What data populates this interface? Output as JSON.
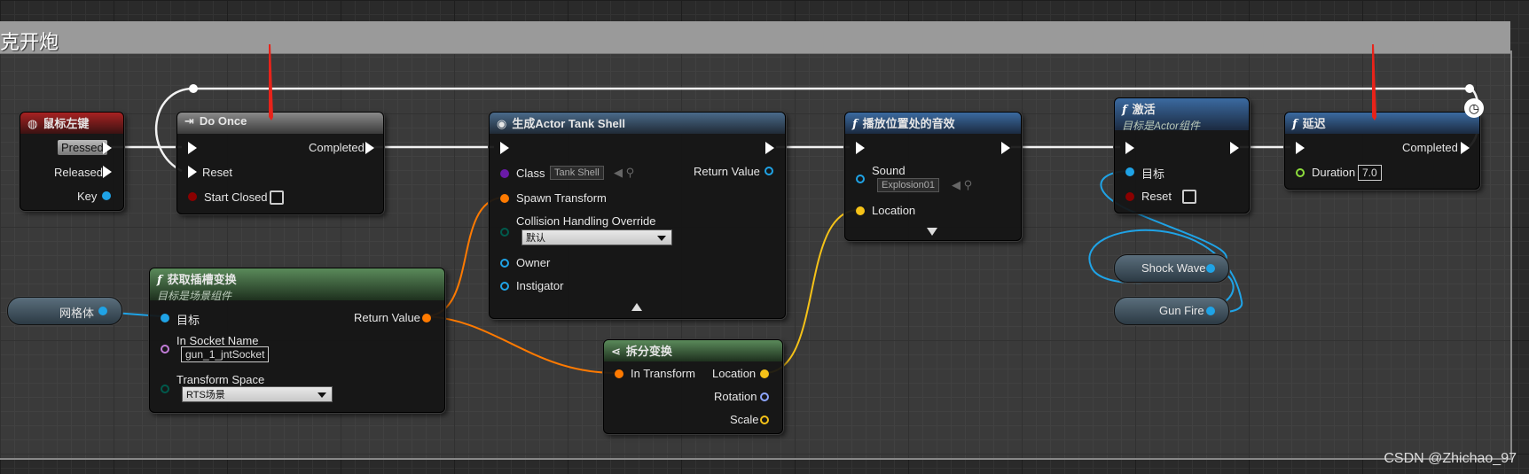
{
  "comment": {
    "title": "克开炮"
  },
  "nodes": {
    "mouse": {
      "title": "鼠标左键",
      "pins": [
        "Pressed",
        "Released",
        "Key"
      ]
    },
    "do_once": {
      "title": "Do Once",
      "pins": [
        "Reset",
        "Start Closed",
        "Completed"
      ]
    },
    "spawn": {
      "title": "生成Actor Tank Shell",
      "class_label": "Class",
      "class_value": "Tank Shell",
      "spawn_transform": "Spawn Transform",
      "collision": "Collision Handling Override",
      "collision_value": "默认",
      "owner": "Owner",
      "instigator": "Instigator",
      "return_value": "Return Value"
    },
    "sound": {
      "title": "播放位置处的音效",
      "sound_label": "Sound",
      "sound_value": "Explosion01",
      "location": "Location"
    },
    "activate": {
      "title": "激活",
      "subtitle": "目标是Actor组件",
      "target": "目标",
      "reset": "Reset"
    },
    "delay": {
      "title": "延迟",
      "completed": "Completed",
      "duration_label": "Duration",
      "duration_value": "7.0"
    },
    "socket": {
      "title": "获取插槽变换",
      "subtitle": "目标是场景组件",
      "target": "目标",
      "socket_name_label": "In Socket Name",
      "socket_name_value": "gun_1_jntSocket",
      "transform_space_label": "Transform Space",
      "transform_space_value": "RTS场景",
      "return_value": "Return Value"
    },
    "break": {
      "title": "拆分变换",
      "in_transform": "In Transform",
      "location": "Location",
      "rotation": "Rotation",
      "scale": "Scale"
    }
  },
  "variables": {
    "mesh": "网格体",
    "shock_wave": "Shock Wave",
    "gun_fire": "Gun Fire"
  },
  "watermark": "CSDN @Zhichao_97",
  "colors": {
    "exec": "#ffffff",
    "object": "#1fa3e6",
    "struct": "#ff7a00",
    "location": "#f5c218",
    "class": "#6a1aa8",
    "float": "#8ddc3c",
    "bool": "#8b0000",
    "name": "#c27dd8",
    "enum": "#005a4c"
  }
}
